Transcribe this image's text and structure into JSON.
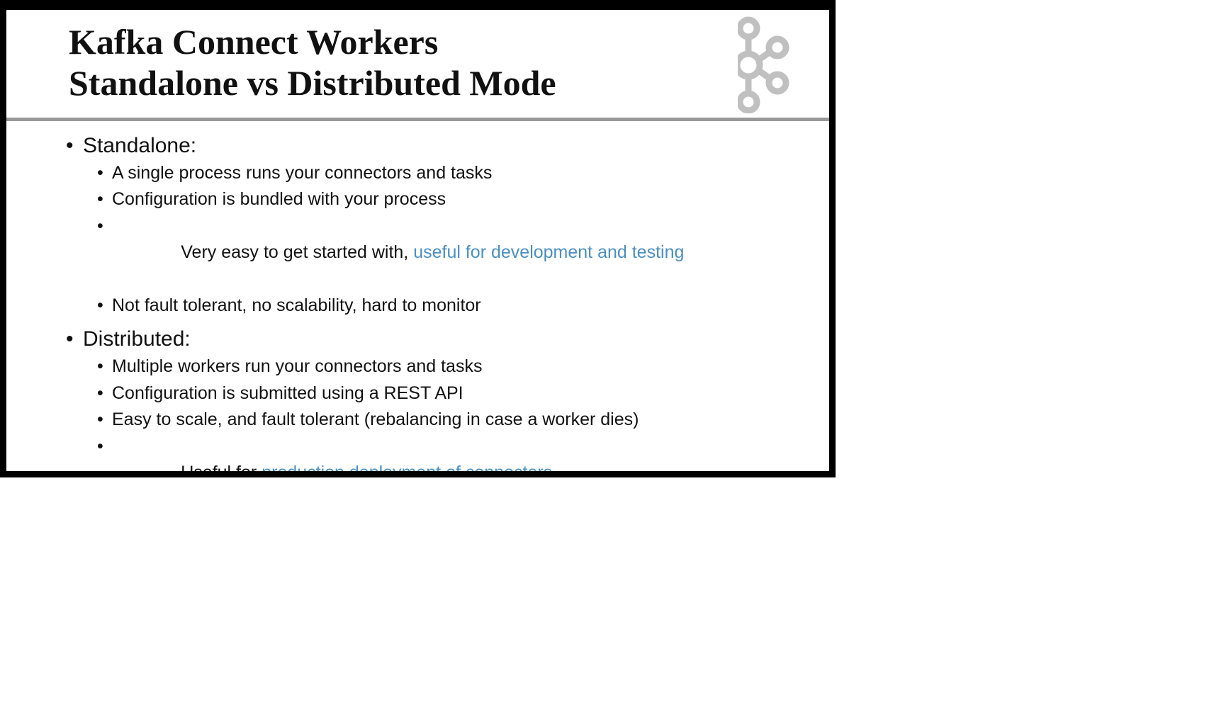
{
  "slide": {
    "title_line1": "Kafka Connect Workers",
    "title_line2": "Standalone vs Distributed Mode",
    "logo_icon": "kafka-logo-icon",
    "bullet_glyph": "•",
    "colors": {
      "highlight": "#4a8fc2",
      "rule": "#999999",
      "logo": "#c0c0c0",
      "frame": "#000000"
    },
    "sections": [
      {
        "heading": "Standalone:",
        "items": [
          {
            "text": "A single process runs your connectors and tasks",
            "highlight": ""
          },
          {
            "text": "Configuration is bundled with your process",
            "highlight": ""
          },
          {
            "text": "Very easy to get started with, ",
            "highlight": "useful for development and testing"
          },
          {
            "text": "Not fault tolerant, no scalability, hard to monitor",
            "highlight": ""
          }
        ]
      },
      {
        "heading": "Distributed:",
        "items": [
          {
            "text": "Multiple workers run your connectors and tasks",
            "highlight": ""
          },
          {
            "text": "Configuration is submitted using a REST API",
            "highlight": ""
          },
          {
            "text": "Easy to scale, and fault tolerant (rebalancing in case a worker dies)",
            "highlight": ""
          },
          {
            "text": "Useful for ",
            "highlight": "production deployment of connectors"
          }
        ]
      }
    ]
  }
}
